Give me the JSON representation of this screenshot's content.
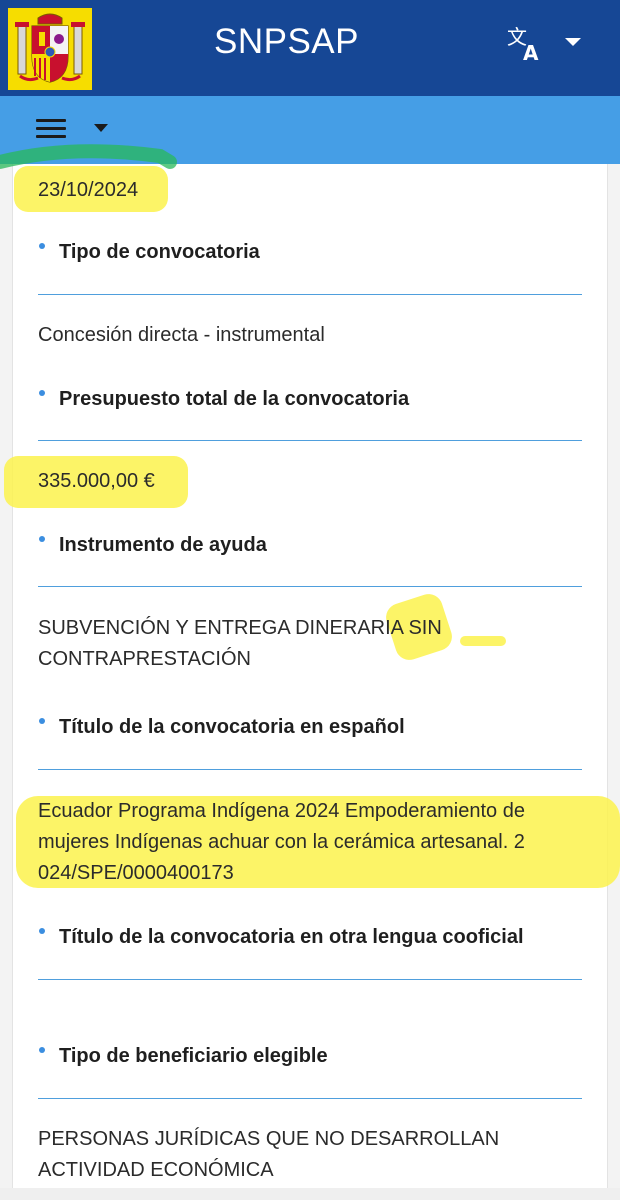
{
  "header": {
    "app_title": "SNPSAP",
    "crest_icon": "coat-of-arms-icon",
    "language_icon": "translate-icon",
    "language_dropdown_icon": "caret-down-icon",
    "background_color": "#164795"
  },
  "toolbar": {
    "menu_icon": "hamburger-menu-icon",
    "menu_dropdown_icon": "caret-down-icon",
    "background_color": "#459ee6"
  },
  "details": {
    "date_value": "23/10/2024",
    "fields": [
      {
        "label": "Tipo de convocatoria",
        "value": "Concesión directa - instrumental"
      },
      {
        "label": "Presupuesto total de la convocatoria",
        "value": "335.000,00 €"
      },
      {
        "label": "Instrumento de ayuda",
        "value_lines": [
          "SUBVENCIÓN Y ENTREGA DINERARIA SIN",
          "CONTRAPRESTACIÓN"
        ]
      },
      {
        "label": "Título de la convocatoria en español",
        "value_lines": [
          "Ecuador Programa Indígena 2024 Empoderamiento de",
          "mujeres Indígenas achuar con la cerámica artesanal. 2",
          "024/SPE/0000400173"
        ]
      },
      {
        "label": "Título de la convocatoria en otra lengua cooficial",
        "value": ""
      },
      {
        "label": "Tipo de beneficiario elegible",
        "value_lines": [
          "PERSONAS JURÍDICAS QUE NO DESARROLLAN",
          "ACTIVIDAD ECONÓMICA"
        ]
      }
    ]
  },
  "colors": {
    "highlight": "#fbf24c",
    "divider": "#4f9fdd",
    "bullet": "#3b8ee0"
  }
}
